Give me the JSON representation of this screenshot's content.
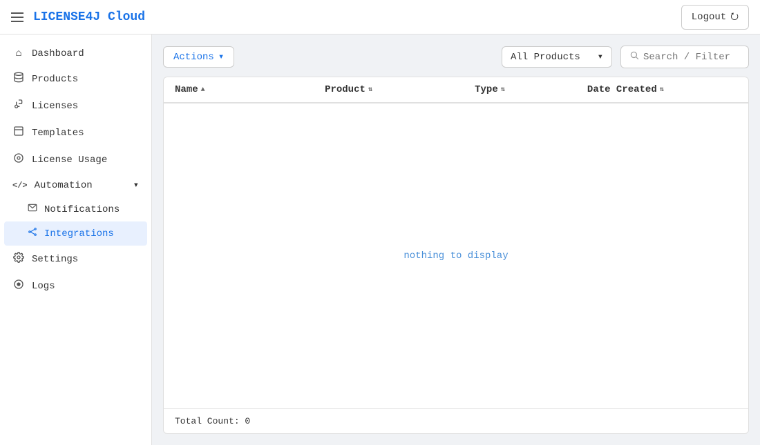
{
  "topbar": {
    "brand": "LICENSE4J Cloud",
    "logout_label": "Logout",
    "logout_icon": "⭮"
  },
  "sidebar": {
    "items": [
      {
        "id": "dashboard",
        "label": "Dashboard",
        "icon": "⌂",
        "active": false
      },
      {
        "id": "products",
        "label": "Products",
        "icon": "☁",
        "active": false
      },
      {
        "id": "licenses",
        "label": "Licenses",
        "icon": "🔑",
        "active": false
      },
      {
        "id": "templates",
        "label": "Templates",
        "icon": "▭",
        "active": false
      },
      {
        "id": "license-usage",
        "label": "License Usage",
        "icon": "⊙",
        "active": false
      },
      {
        "id": "automation",
        "label": "Automation",
        "icon": "</>",
        "active": false,
        "expanded": true
      },
      {
        "id": "notifications",
        "label": "Notifications",
        "icon": "✉",
        "active": false,
        "sub": true
      },
      {
        "id": "integrations",
        "label": "Integrations",
        "icon": "⚙",
        "active": true,
        "sub": true
      },
      {
        "id": "settings",
        "label": "Settings",
        "icon": "🔧",
        "active": false
      },
      {
        "id": "logs",
        "label": "Logs",
        "icon": "◉",
        "active": false
      }
    ]
  },
  "toolbar": {
    "actions_label": "Actions",
    "actions_chevron": "▾",
    "products_filter": "All Products",
    "products_chevron": "▾",
    "search_placeholder": "Search / Filter",
    "search_icon": "🔍"
  },
  "table": {
    "columns": [
      {
        "label": "Name",
        "sort": "▲"
      },
      {
        "label": "Product",
        "sort": "⇅"
      },
      {
        "label": "Type",
        "sort": "⇅"
      },
      {
        "label": "Date Created",
        "sort": "⇅"
      }
    ],
    "empty_message": "nothing to display",
    "footer": "Total Count: 0"
  }
}
